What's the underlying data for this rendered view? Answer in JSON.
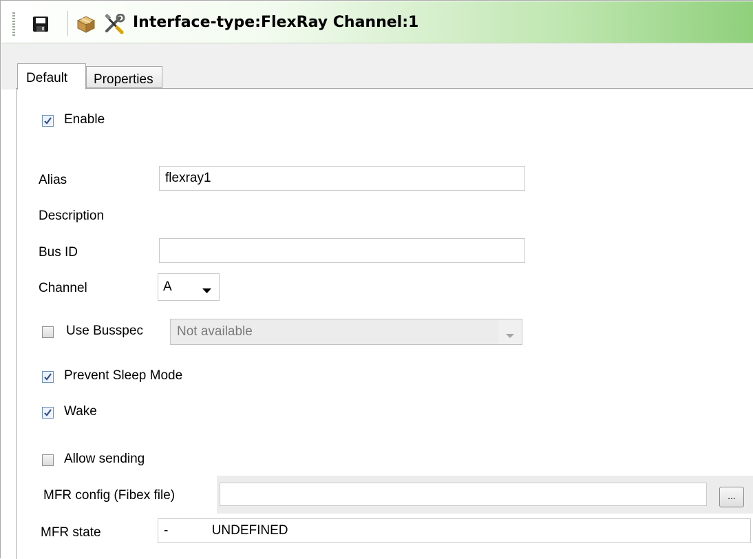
{
  "titlebar": {
    "title": "Interface-type:FlexRay Channel:1",
    "icons": [
      "save-icon",
      "package-icon",
      "tools-icon"
    ]
  },
  "tabs": [
    {
      "label": "Default",
      "active": true
    },
    {
      "label": "Properties",
      "active": false
    }
  ],
  "form": {
    "enable": {
      "label": "Enable",
      "checked": true
    },
    "alias": {
      "label": "Alias",
      "value": "flexray1"
    },
    "description": {
      "label": "Description"
    },
    "bus_id": {
      "label": "Bus ID",
      "value": ""
    },
    "channel": {
      "label": "Channel",
      "value": "A"
    },
    "use_busspec": {
      "label": "Use Busspec",
      "checked": false,
      "value": "Not available",
      "disabled": true
    },
    "prevent_sleep": {
      "label": "Prevent Sleep Mode",
      "checked": true
    },
    "wake": {
      "label": "Wake",
      "checked": true
    },
    "allow_sending": {
      "label": "Allow sending",
      "checked": false
    },
    "mfr_config": {
      "label": "MFR config (Fibex file)",
      "value": "",
      "browse_label": "..."
    },
    "mfr_state": {
      "label": "MFR state",
      "value": "-            UNDEFINED"
    }
  },
  "colors": {
    "title_gradient_end": "#8fd07c",
    "checkbox_check": "#2f4f8f",
    "border": "#a9a9a9"
  }
}
